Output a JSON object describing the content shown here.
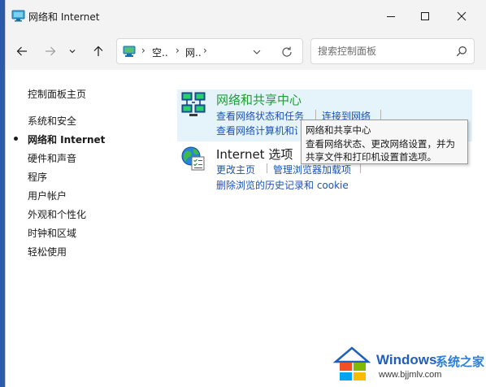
{
  "window": {
    "title": "网络和 Internet"
  },
  "toolbar": {
    "breadcrumbs": [
      "空..",
      "网..",
      ""
    ],
    "search_placeholder": "搜索控制面板"
  },
  "sidebar": {
    "items": [
      {
        "label": "控制面板主页",
        "active": false
      },
      {
        "label": "系统和安全",
        "active": false
      },
      {
        "label": "网络和 Internet",
        "active": true
      },
      {
        "label": "硬件和声音",
        "active": false
      },
      {
        "label": "程序",
        "active": false
      },
      {
        "label": "用户帐户",
        "active": false
      },
      {
        "label": "外观和个性化",
        "active": false
      },
      {
        "label": "时钟和区域",
        "active": false
      },
      {
        "label": "轻松使用",
        "active": false
      }
    ]
  },
  "categories": [
    {
      "title": "网络和共享中心",
      "links": [
        "查看网络状态和任务",
        "连接到网络",
        "查看网络计算机和设备"
      ],
      "highlighted": true
    },
    {
      "title": "Internet 选项",
      "links": [
        "更改主页",
        "管理浏览器加载项",
        "删除浏览的历史记录和 cookie"
      ],
      "highlighted": false
    }
  ],
  "tooltip": {
    "lines": [
      "网络和共享中心",
      "查看网络状态、更改网络设置，并为",
      "共享文件和打印机设置首选项。"
    ]
  },
  "watermark": {
    "brand": "Windows",
    "site_name": "系统之家",
    "url": "www.bjjmlv.com"
  },
  "colors": {
    "title_green": "#1e9e35",
    "link_blue": "#1c52b8",
    "highlight_bg": "#e5f3fb"
  }
}
